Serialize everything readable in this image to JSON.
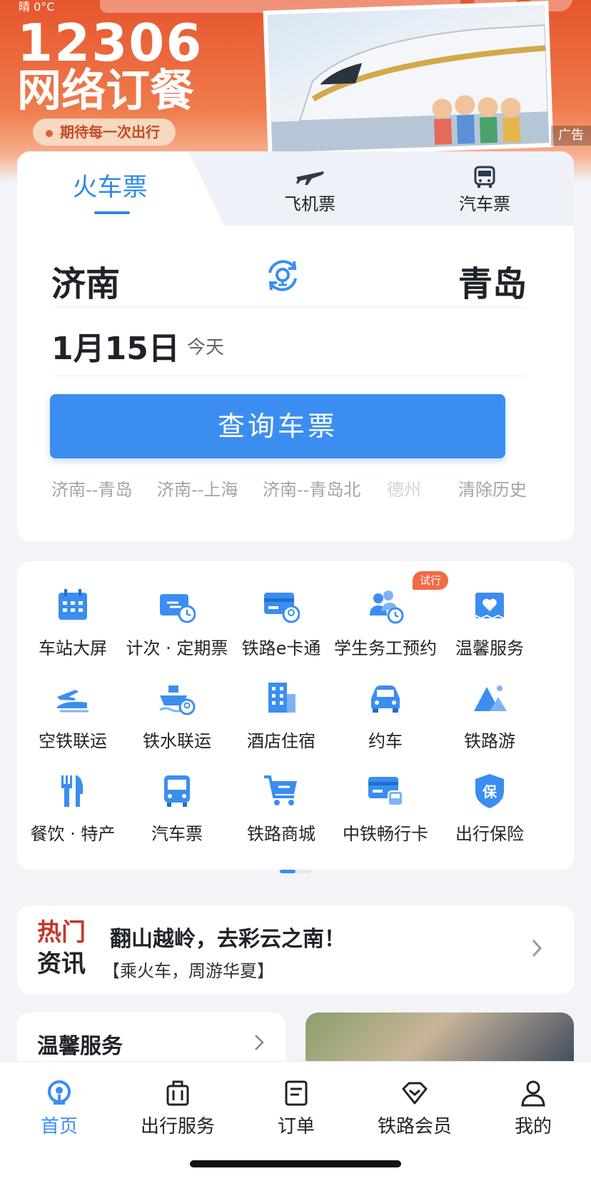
{
  "banner": {
    "status": "晴 0°C",
    "title_line1": "12306",
    "title_line2": "网络订餐",
    "slogan": "期待每一次出行",
    "ad_tag": "广告"
  },
  "mode_tabs": [
    {
      "label": "火车票",
      "active": true
    },
    {
      "label": "飞机票",
      "active": false
    },
    {
      "label": "汽车票",
      "active": false
    }
  ],
  "search": {
    "from_city": "济南",
    "to_city": "青岛",
    "date": "1月15日",
    "day_label": "今天",
    "button_label": "查询车票",
    "history": [
      "济南--青岛",
      "济南--上海",
      "济南--青岛北",
      "德州"
    ],
    "clear_history": "清除历史"
  },
  "services": [
    {
      "label": "车站大屏",
      "icon": "calendar-screen-icon"
    },
    {
      "label": "计次 · 定期票",
      "icon": "ticket-clock-icon"
    },
    {
      "label": "铁路e卡通",
      "icon": "rail-card-icon"
    },
    {
      "label": "学生务工预约",
      "icon": "people-clock-icon",
      "badge": "试行"
    },
    {
      "label": "温馨服务",
      "icon": "heart-box-icon"
    },
    {
      "label": "空铁联运",
      "icon": "plane-train-icon"
    },
    {
      "label": "铁水联运",
      "icon": "ship-train-icon"
    },
    {
      "label": "酒店住宿",
      "icon": "hotel-icon"
    },
    {
      "label": "约车",
      "icon": "car-icon"
    },
    {
      "label": "铁路游",
      "icon": "mountain-icon"
    },
    {
      "label": "餐饮 · 特产",
      "icon": "fork-knife-icon"
    },
    {
      "label": "汽车票",
      "icon": "bus-icon"
    },
    {
      "label": "铁路商城",
      "icon": "cart-icon"
    },
    {
      "label": "中铁畅行卡",
      "icon": "card-train-icon"
    },
    {
      "label": "出行保险",
      "icon": "shield-icon"
    }
  ],
  "news": {
    "tag_line1": "热门",
    "tag_line2": "资讯",
    "title": "翻山越岭，去彩云之南！",
    "subtitle": "【乘火车，周游华夏】"
  },
  "warm_service": {
    "title": "温馨服务"
  },
  "tabbar": [
    {
      "label": "首页",
      "active": true
    },
    {
      "label": "出行服务",
      "active": false
    },
    {
      "label": "订单",
      "active": false
    },
    {
      "label": "铁路会员",
      "active": false
    },
    {
      "label": "我的",
      "active": false
    }
  ],
  "colors": {
    "accent": "#3b8ef0",
    "banner": "#e6552e",
    "badge": "#f26a45"
  }
}
